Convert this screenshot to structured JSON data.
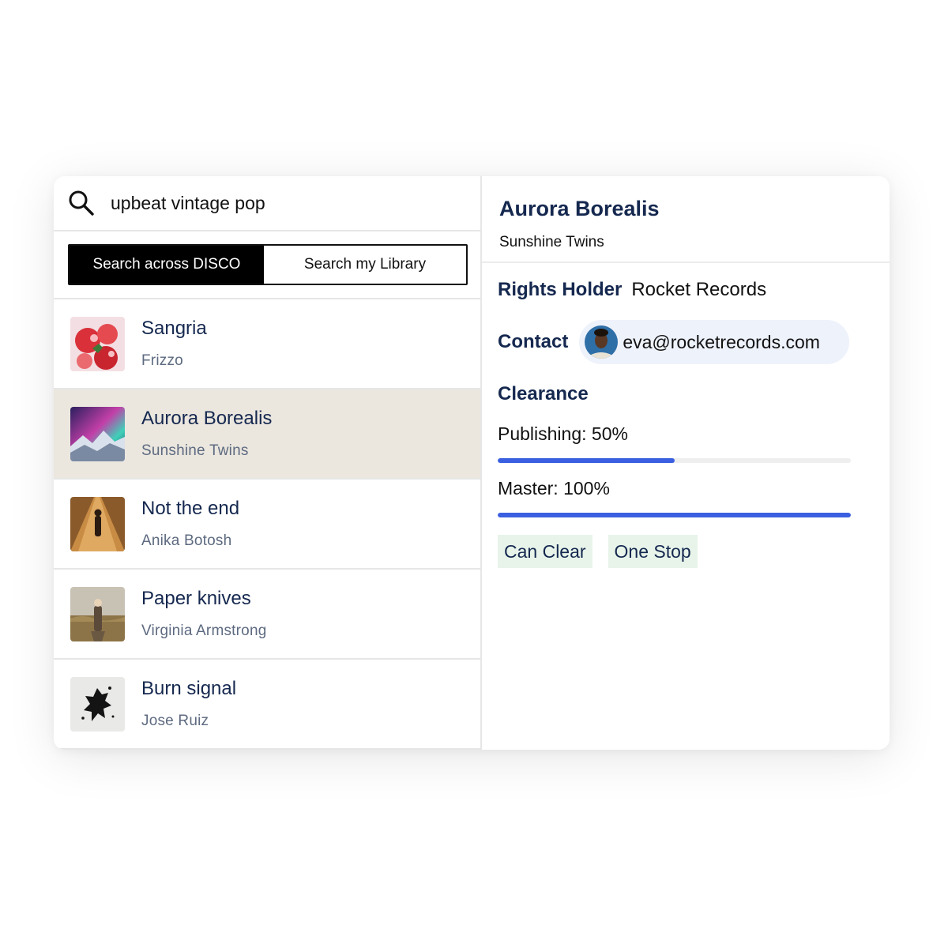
{
  "search": {
    "query": "upbeat vintage pop",
    "icon": "search-icon"
  },
  "toggle": {
    "options": [
      "Search across DISCO",
      "Search my Library"
    ],
    "active": 0
  },
  "tracks": [
    {
      "title": "Sangria",
      "artist": "Frizzo"
    },
    {
      "title": "Aurora Borealis",
      "artist": "Sunshine Twins",
      "selected": true
    },
    {
      "title": "Not the end",
      "artist": "Anika Botosh"
    },
    {
      "title": "Paper knives",
      "artist": "Virginia Armstrong"
    },
    {
      "title": "Burn signal",
      "artist": "Jose Ruiz"
    }
  ],
  "detail": {
    "title": "Aurora Borealis",
    "artist": "Sunshine Twins",
    "rights_label": "Rights Holder",
    "rights_value": "Rocket Records",
    "contact_label": "Contact",
    "contact_email": "eva@rocketrecords.com",
    "clearance_label": "Clearance",
    "publishing_label": "Publishing: 50%",
    "publishing_value": 0.5,
    "master_label": "Master: 100%",
    "master_value": 1.0,
    "tags": [
      "Can Clear",
      "One Stop"
    ]
  },
  "colors": {
    "accent": "#3a5fe0",
    "navy": "#15284f",
    "selected_row": "#ebe7df",
    "tag_bg": "#e8f4ea",
    "pill_bg": "#eef2fb"
  }
}
